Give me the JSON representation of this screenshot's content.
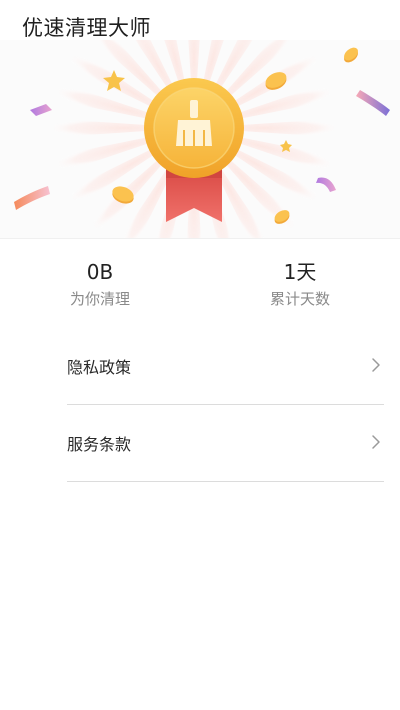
{
  "app": {
    "title": "优速清理大师"
  },
  "stats": {
    "cleaned": {
      "value": "0B",
      "label": "为你清理"
    },
    "days": {
      "value": "1天",
      "label": "累计天数"
    }
  },
  "menu": {
    "items": [
      {
        "label": "隐私政策"
      },
      {
        "label": "服务条款"
      }
    ]
  },
  "colors": {
    "medal_gold": "#f5b63a",
    "medal_inner": "#f8c64c",
    "ribbon_red": "#ea5b55",
    "ray_pink": "#fde2de",
    "text_secondary": "#8a8a8a",
    "divider": "#dcdcdc"
  },
  "icons": {
    "medal": "broom-medal-icon",
    "chevron": "chevron-right-icon"
  }
}
